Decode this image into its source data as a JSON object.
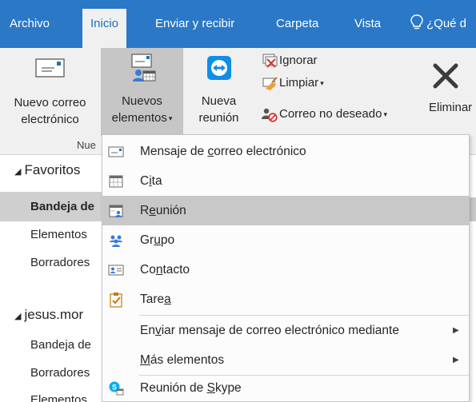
{
  "tabs": [
    {
      "label": "Archivo",
      "active": false
    },
    {
      "label": "Inicio",
      "active": true
    },
    {
      "label": "Enviar y recibir",
      "active": false
    },
    {
      "label": "Carpeta",
      "active": false
    },
    {
      "label": "Vista",
      "active": false
    }
  ],
  "tell_me": "¿Qué d",
  "ribbon": {
    "new_email": {
      "line1": "Nuevo correo",
      "line2": "electrónico"
    },
    "new_items": {
      "line1": "Nuevos",
      "line2": "elementos"
    },
    "new_meeting": {
      "line1": "Nueva",
      "line2": "reunión"
    },
    "ignore": "Ignorar",
    "clean_up": "Limpiar",
    "junk": "Correo no deseado",
    "delete": "Eliminar",
    "group_new_partial": "Nue"
  },
  "folders": {
    "favorites": "Favoritos",
    "inbox_fav": "Bandeja de",
    "sent_fav": "Elementos",
    "drafts_fav": "Borradores",
    "account": "jesus.mor",
    "inbox_acc": "Bandeja de",
    "drafts_acc": "Borradores",
    "items_acc": "Elementos"
  },
  "menu": {
    "items": [
      {
        "pre": "Mensaje de ",
        "ul": "c",
        "post": "orreo electrónico",
        "icon": "email-message-icon"
      },
      {
        "pre": "C",
        "ul": "i",
        "post": "ta",
        "icon": "appointment-icon"
      },
      {
        "pre": "R",
        "ul": "e",
        "post": "unión",
        "icon": "meeting-icon"
      },
      {
        "pre": "Gr",
        "ul": "u",
        "post": "po",
        "icon": "group-icon"
      },
      {
        "pre": "Co",
        "ul": "n",
        "post": "tacto",
        "icon": "contact-icon"
      },
      {
        "pre": "Tare",
        "ul": "a",
        "post": "",
        "icon": "task-icon"
      },
      {
        "pre": "En",
        "ul": "v",
        "post": "iar mensaje de correo electrónico mediante",
        "icon": ""
      },
      {
        "pre": "",
        "ul": "M",
        "post": "ás elementos",
        "icon": ""
      },
      {
        "pre": "Reunión de ",
        "ul": "S",
        "post": "kype",
        "icon": "skype-meeting-icon"
      }
    ],
    "hovered_index": 2
  },
  "colors": {
    "accent": "#2b78c6",
    "ribbon_bg": "#f0f0f0",
    "hover": "#c8c8c8"
  }
}
